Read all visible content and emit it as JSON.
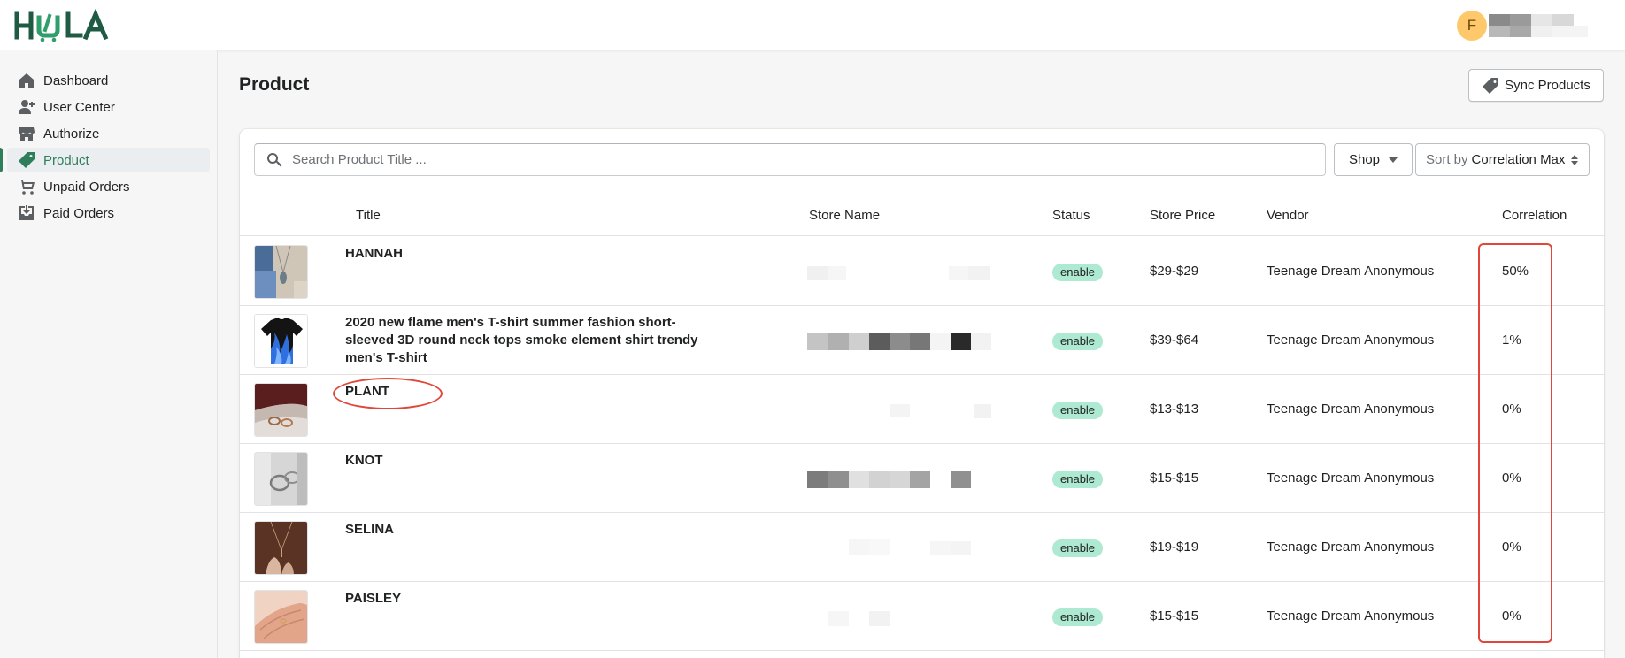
{
  "app": {
    "logo_text": "HOLA",
    "brand_color": "#2e7d5b",
    "user_initial": "F"
  },
  "sidebar": {
    "items": [
      {
        "label": "Dashboard",
        "icon": "home-icon",
        "active": false
      },
      {
        "label": "User Center",
        "icon": "user-plus-icon",
        "active": false
      },
      {
        "label": "Authorize",
        "icon": "store-icon",
        "active": false
      },
      {
        "label": "Product",
        "icon": "tag-icon",
        "active": true
      },
      {
        "label": "Unpaid Orders",
        "icon": "cart-icon",
        "active": false
      },
      {
        "label": "Paid Orders",
        "icon": "inbox-download-icon",
        "active": false
      }
    ]
  },
  "page": {
    "title": "Product",
    "sync_label": "Sync Products"
  },
  "filters": {
    "search_placeholder": "Search Product Title ...",
    "shop_label": "Shop",
    "sort_prefix": "Sort by",
    "sort_value": "Correlation Max"
  },
  "table": {
    "columns": {
      "title": "Title",
      "store_name": "Store Name",
      "status": "Status",
      "store_price": "Store Price",
      "vendor": "Vendor",
      "correlation": "Correlation"
    },
    "rows": [
      {
        "title": "HANNAH",
        "status": "enable",
        "price": "$29-$29",
        "vendor": "Teenage Dream Anonymous",
        "correlation": "50%"
      },
      {
        "title": "2020 new flame men's T-shirt summer fashion short-sleeved 3D round neck tops smoke element shirt trendy men's T-shirt",
        "status": "enable",
        "price": "$39-$64",
        "vendor": "Teenage Dream Anonymous",
        "correlation": "1%"
      },
      {
        "title": "PLANT",
        "status": "enable",
        "price": "$13-$13",
        "vendor": "Teenage Dream Anonymous",
        "correlation": "0%"
      },
      {
        "title": "KNOT",
        "status": "enable",
        "price": "$15-$15",
        "vendor": "Teenage Dream Anonymous",
        "correlation": "0%"
      },
      {
        "title": "SELINA",
        "status": "enable",
        "price": "$19-$19",
        "vendor": "Teenage Dream Anonymous",
        "correlation": "0%"
      },
      {
        "title": "PAISLEY",
        "status": "enable",
        "price": "$15-$15",
        "vendor": "Teenage Dream Anonymous",
        "correlation": "0%"
      }
    ]
  },
  "colors": {
    "badge_bg": "#aee9d1",
    "highlight": "#e0473a"
  }
}
